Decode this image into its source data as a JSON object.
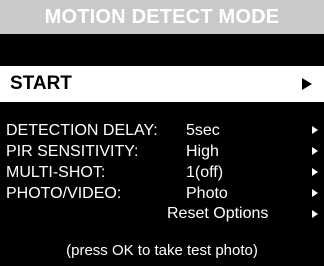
{
  "header": {
    "title": "MOTION DETECT MODE"
  },
  "start": {
    "label": "START"
  },
  "settings": [
    {
      "label": "DETECTION DELAY:",
      "value": "5sec"
    },
    {
      "label": "PIR SENSITIVITY:",
      "value": "High"
    },
    {
      "label": "MULTI-SHOT:",
      "value": "1(off)"
    },
    {
      "label": "PHOTO/VIDEO:",
      "value": "Photo"
    }
  ],
  "reset": {
    "label": "Reset Options"
  },
  "hint": {
    "text": "(press OK to take test photo)"
  },
  "colors": {
    "title_bar": "#c9c9c9",
    "background": "#000000",
    "highlight": "#ffffff"
  },
  "icons": {
    "start_arrow": "play-arrow-icon",
    "row_arrow": "chevron-right-icon"
  }
}
